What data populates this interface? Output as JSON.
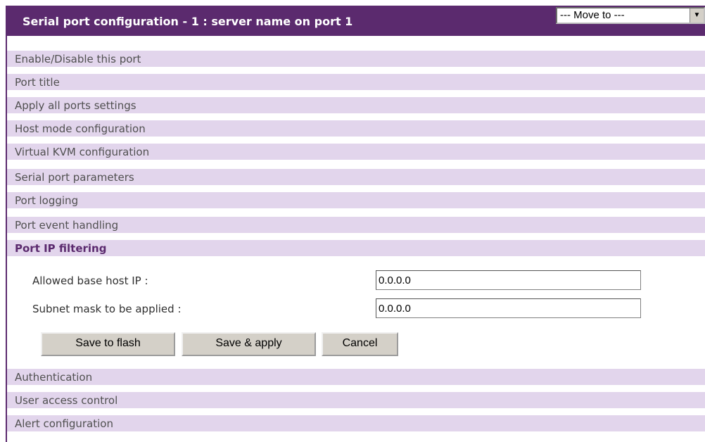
{
  "header": {
    "title": "Serial port configuration - 1 : server name on port 1",
    "move_to": "--- Move to ---"
  },
  "sections_top": [
    {
      "label": "Enable/Disable this port"
    },
    {
      "label": "Port title"
    },
    {
      "label": "Apply all ports settings"
    },
    {
      "label": "Host mode configuration"
    },
    {
      "label": "Virtual KVM configuration"
    },
    {
      "label": "Serial port parameters"
    },
    {
      "label": "Port logging"
    },
    {
      "label": "Port event handling"
    }
  ],
  "active_section": {
    "label": "Port IP filtering"
  },
  "form": {
    "allowed_host_label": "Allowed base host IP :",
    "allowed_host_value": "0.0.0.0",
    "subnet_mask_label": "Subnet mask to be applied :",
    "subnet_mask_value": "0.0.0.0"
  },
  "buttons": {
    "save_flash": "Save to flash",
    "save_apply": "Save & apply",
    "cancel": "Cancel"
  },
  "sections_bottom": [
    {
      "label": "Authentication"
    },
    {
      "label": "User access control"
    },
    {
      "label": "Alert configuration"
    }
  ]
}
